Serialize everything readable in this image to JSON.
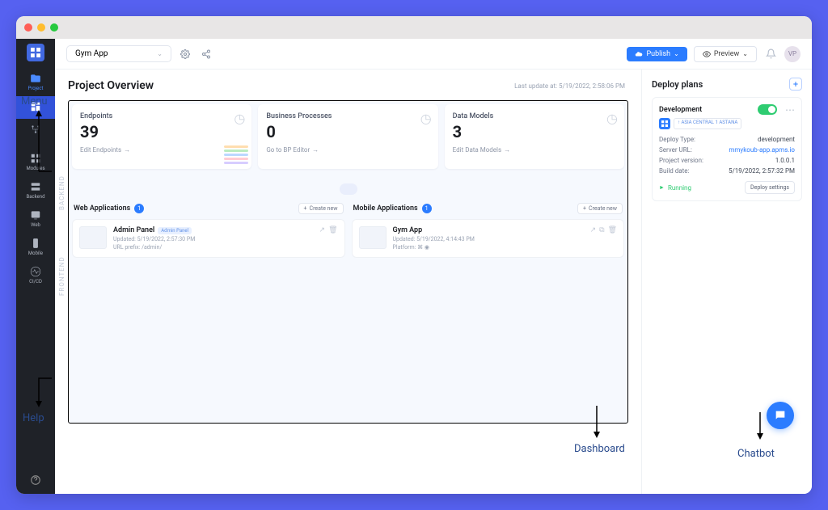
{
  "annotations": {
    "menu": "Menu",
    "help": "Help",
    "dashboard": "Dashboard",
    "chatbot": "Chatbot"
  },
  "topbar": {
    "project_name": "Gym App",
    "publish_label": "Publish",
    "preview_label": "Preview",
    "avatar_initials": "VP"
  },
  "sidebar": {
    "section_backend": "BACKEND",
    "section_frontend": "FRONTEND",
    "items": {
      "project": "Project",
      "designer": "",
      "modules": "Modules",
      "backend": "Backend",
      "web": "Web",
      "mobile": "Mobile",
      "cicd": "CI/CD"
    }
  },
  "overview": {
    "title": "Project Overview",
    "last_update_label": "Last update at:",
    "last_update_value": "5/19/2022, 2:58:06 PM"
  },
  "stats": {
    "endpoints": {
      "label": "Endpoints",
      "value": "39",
      "link": "Edit Endpoints"
    },
    "bp": {
      "label": "Business Processes",
      "value": "0",
      "link": "Go to BP Editor"
    },
    "models": {
      "label": "Data Models",
      "value": "3",
      "link": "Edit Data Models"
    }
  },
  "webapps": {
    "title": "Web Applications",
    "count": "1",
    "create_label": "Create new",
    "items": [
      {
        "name": "Admin Panel",
        "tag": "Admin Panel",
        "updated": "Updated: 5/19/2022, 2:57:30 PM",
        "extra": "URL prefix: /admin/"
      }
    ]
  },
  "mobileapps": {
    "title": "Mobile Applications",
    "count": "1",
    "create_label": "Create new",
    "items": [
      {
        "name": "Gym App",
        "updated": "Updated: 5/19/2022, 4:14:43 PM",
        "extra": "Platform:"
      }
    ]
  },
  "deploy": {
    "panel_title": "Deploy plans",
    "env": "Development",
    "region": "↑ ASIA CENTRAL 1 ASTANA",
    "rows": {
      "type_label": "Deploy Type:",
      "type_value": "development",
      "url_label": "Server URL:",
      "url_value": "mmykoub-app.apms.io",
      "ver_label": "Project version:",
      "ver_value": "1.0.0.1",
      "build_label": "Build date:",
      "build_value": "5/19/2022, 2:57:32 PM"
    },
    "status": "Running",
    "settings_label": "Deploy settings"
  }
}
